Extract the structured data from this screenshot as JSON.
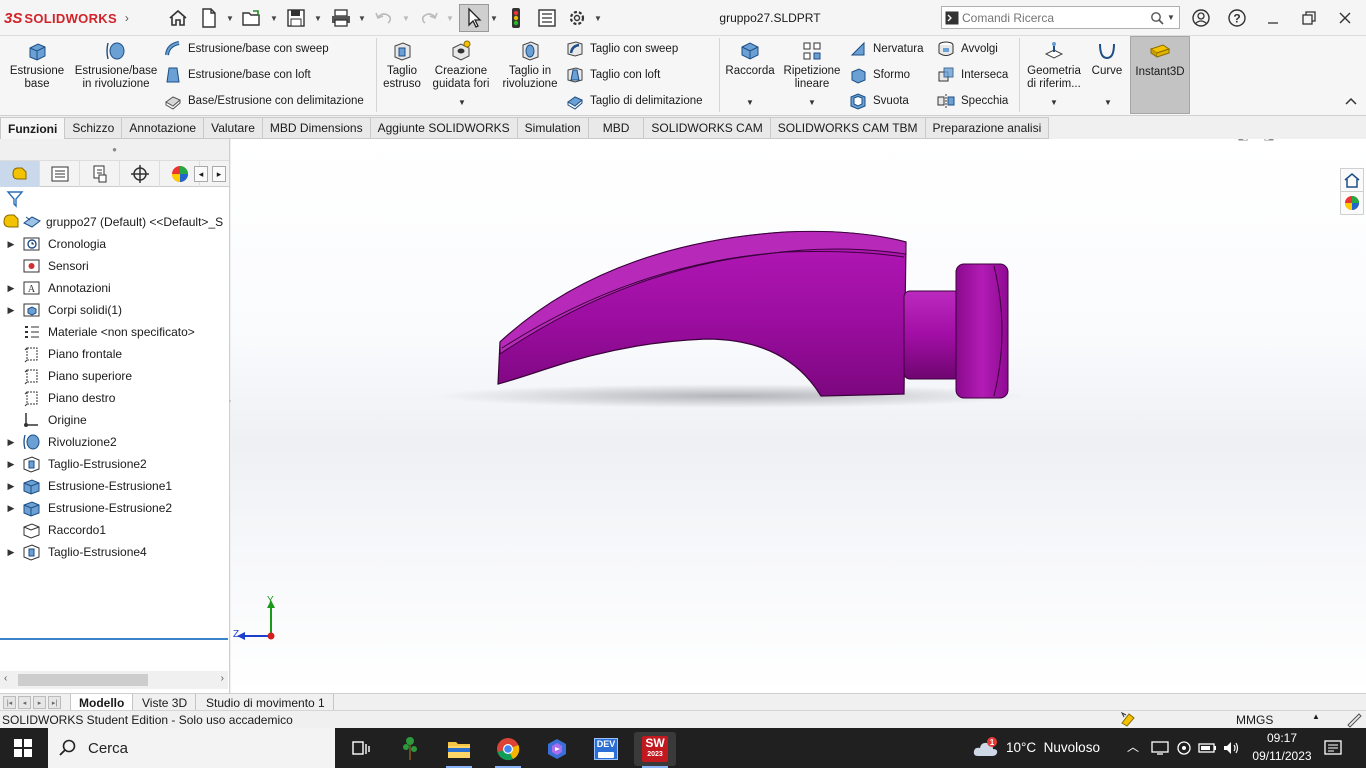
{
  "app": {
    "name": "SOLIDWORKS",
    "logo_ds": "3S"
  },
  "window": {
    "doc_title": "gruppo27.SLDPRT"
  },
  "search": {
    "placeholder": "Comandi Ricerca"
  },
  "ribbon": {
    "estrusione_base": [
      "Estrusione",
      "base"
    ],
    "estrusione_rivoluzione": [
      "Estrusione/base",
      "in rivoluzione"
    ],
    "estrusione_sweep": "Estrusione/base con sweep",
    "estrusione_loft": "Estrusione/base con loft",
    "base_delimitazione": "Base/Estrusione con delimitazione",
    "taglio_estruso": [
      "Taglio",
      "estruso"
    ],
    "creazione_fori": [
      "Creazione",
      "guidata fori"
    ],
    "taglio_rivoluzione": [
      "Taglio in",
      "rivoluzione"
    ],
    "taglio_sweep": "Taglio con sweep",
    "taglio_loft": "Taglio con loft",
    "taglio_delimitazione": "Taglio di delimitazione",
    "raccorda": "Raccorda",
    "ripetizione_lineare": [
      "Ripetizione",
      "lineare"
    ],
    "nervatura": "Nervatura",
    "sformo": "Sformo",
    "svuota": "Svuota",
    "avvolgi": "Avvolgi",
    "interseca": "Interseca",
    "specchia": "Specchia",
    "geometria_riferimento": [
      "Geometria",
      "di riferim..."
    ],
    "curve": "Curve",
    "instant3d": "Instant3D"
  },
  "tabs": [
    "Funzioni",
    "Schizzo",
    "Annotazione",
    "Valutare",
    "MBD Dimensions",
    "Aggiunte SOLIDWORKS",
    "Simulation",
    "MBD",
    "SOLIDWORKS CAM",
    "SOLIDWORKS CAM TBM",
    "Preparazione analisi"
  ],
  "tree": {
    "root": "gruppo27 (Default) <<Default>_S",
    "items": [
      {
        "label": "Cronologia",
        "icon": "history-folder-icon",
        "expandable": true
      },
      {
        "label": "Sensori",
        "icon": "sensor-icon",
        "expandable": false
      },
      {
        "label": "Annotazioni",
        "icon": "annotation-icon",
        "expandable": true
      },
      {
        "label": "Corpi solidi(1)",
        "icon": "solid-bodies-icon",
        "expandable": true
      },
      {
        "label": "Materiale <non specificato>",
        "icon": "material-icon",
        "expandable": false
      },
      {
        "label": "Piano frontale",
        "icon": "plane-icon",
        "expandable": false
      },
      {
        "label": "Piano superiore",
        "icon": "plane-icon",
        "expandable": false
      },
      {
        "label": "Piano destro",
        "icon": "plane-icon",
        "expandable": false
      },
      {
        "label": "Origine",
        "icon": "origin-icon",
        "expandable": false
      },
      {
        "label": "Rivoluzione2",
        "icon": "revolve-icon",
        "expandable": true
      },
      {
        "label": "Taglio-Estrusione2",
        "icon": "cut-extrude-icon",
        "expandable": true
      },
      {
        "label": "Estrusione-Estrusione1",
        "icon": "boss-extrude-icon",
        "expandable": true
      },
      {
        "label": "Estrusione-Estrusione2",
        "icon": "boss-extrude-icon",
        "expandable": true
      },
      {
        "label": "Raccordo1",
        "icon": "fillet-icon",
        "expandable": false
      },
      {
        "label": "Taglio-Estrusione4",
        "icon": "cut-extrude-icon",
        "expandable": true
      }
    ]
  },
  "triad": {
    "y": "Y",
    "z": "Z"
  },
  "bottom_tabs": [
    "Modello",
    "Viste 3D",
    "Studio di movimento 1"
  ],
  "status": {
    "left": "SOLIDWORKS Student Edition - Solo uso accademico",
    "units": "MMGS"
  },
  "taskbar": {
    "search": "Cerca",
    "weather": "10°C  Nuvoloso",
    "time": "09:17",
    "date": "09/11/2023",
    "sw_badge": "2023",
    "dev_badge": "DEV"
  },
  "colors": {
    "model": "#a10ea3",
    "accent": "#d2232a",
    "tree_end": "#3a84c9"
  }
}
